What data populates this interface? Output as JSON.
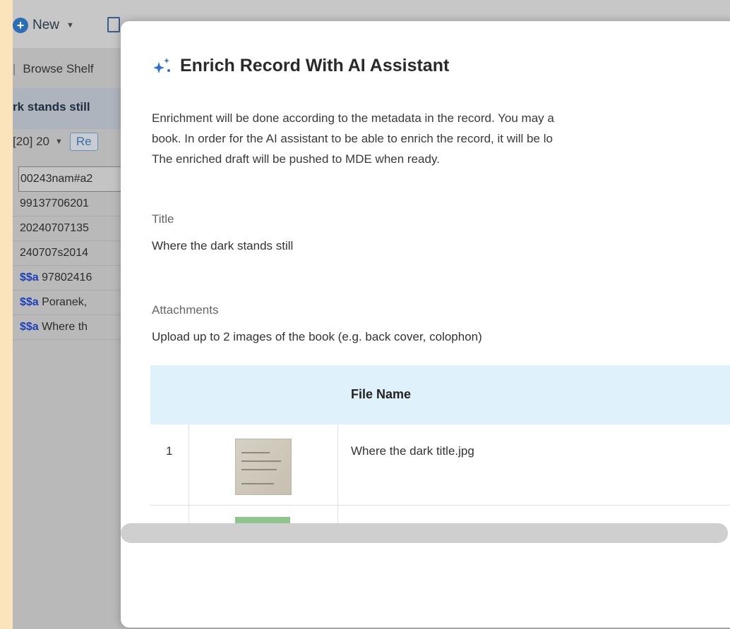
{
  "background_app": {
    "toolbar": {
      "new_label": "New"
    },
    "browse_shelf_label": "Browse Shelf",
    "record_title": "rk stands still",
    "pager": {
      "page_size_label": "[20] 20",
      "button_label": "Re"
    },
    "marc_rows": [
      {
        "prefix": "",
        "text": "00243nam#a2"
      },
      {
        "prefix": "",
        "text": "99137706201"
      },
      {
        "prefix": "",
        "text": "20240707135"
      },
      {
        "prefix": "",
        "text": "240707s2014"
      },
      {
        "prefix": "$$a",
        "text": " 97802416"
      },
      {
        "prefix": "$$a",
        "text": " Poranek,"
      },
      {
        "prefix": "$$a",
        "text": " Where th"
      }
    ]
  },
  "modal": {
    "title": "Enrich Record With AI Assistant",
    "description_lines": [
      "Enrichment will be done according to the metadata in the record. You may a",
      "book. In order for the AI assistant to be able to enrich the record, it will be lo",
      "The enriched draft will be pushed to MDE when ready."
    ],
    "title_field": {
      "label": "Title",
      "value": "Where the dark stands still"
    },
    "attachments": {
      "label": "Attachments",
      "help": "Upload up to 2 images of the book (e.g. back cover, colophon)",
      "columns": {
        "file_name": "File Name"
      },
      "rows": [
        {
          "index": "1",
          "file_name": "Where the dark title.jpg"
        }
      ]
    }
  },
  "colors": {
    "page_bg": "#fbe3bc",
    "overlay": "#b9b9b9",
    "table_header_bg": "#dff1fb",
    "subfield_blue": "#1d3fb8",
    "new_button_blue": "#2a6eb3"
  },
  "icons": [
    "plus-circle-icon",
    "caret-down-icon",
    "sparkle-icon",
    "record-icon"
  ]
}
